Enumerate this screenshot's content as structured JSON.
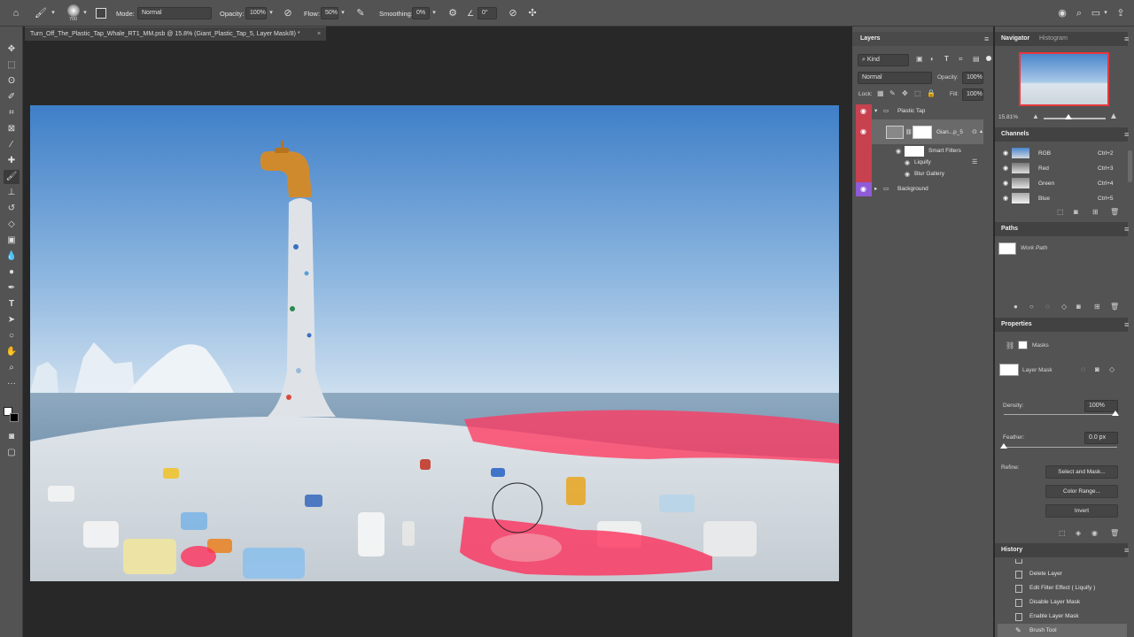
{
  "options_bar": {
    "brush_size": "700",
    "mode_label": "Mode:",
    "mode_value": "Normal",
    "opacity_label": "Opacity:",
    "opacity_value": "100%",
    "flow_label": "Flow:",
    "flow_value": "50%",
    "smoothing_label": "Smoothing:",
    "smoothing_value": "0%",
    "angle_value": "0°"
  },
  "document": {
    "tab_title": "Turn_Off_The_Plastic_Tap_Whale_RT1_MM.psb @ 15.8% (Giant_Plastic_Tap_5, Layer Mask/8) *"
  },
  "layers_panel": {
    "tab": "Layers",
    "filter_kind": "Kind",
    "blend_mode": "Normal",
    "opacity_label": "Opacity:",
    "opacity_value": "100%",
    "lock_label": "Lock:",
    "fill_label": "Fill:",
    "fill_value": "100%",
    "layers": [
      {
        "name": "Plastic Tap"
      },
      {
        "name": "Gian...p_5"
      },
      {
        "name": "Smart Filters"
      },
      {
        "name": "Liquify"
      },
      {
        "name": "Blur Gallery"
      },
      {
        "name": "Background"
      }
    ]
  },
  "navigator_panel": {
    "tab_navigator": "Navigator",
    "tab_histogram": "Histogram",
    "zoom": "15.81%"
  },
  "channels_panel": {
    "tab": "Channels",
    "channels": [
      {
        "name": "RGB",
        "shortcut": "Ctrl+2"
      },
      {
        "name": "Red",
        "shortcut": "Ctrl+3"
      },
      {
        "name": "Green",
        "shortcut": "Ctrl+4"
      },
      {
        "name": "Blue",
        "shortcut": "Ctrl+5"
      }
    ]
  },
  "paths_panel": {
    "tab": "Paths",
    "path_name": "Work Path"
  },
  "properties_panel": {
    "tab": "Properties",
    "section": "Masks",
    "mask_label": "Layer Mask",
    "density_label": "Density:",
    "density_value": "100%",
    "feather_label": "Feather:",
    "feather_value": "0.0 px",
    "refine_label": "Refine:",
    "select_and_mask": "Select and Mask...",
    "color_range": "Color Range...",
    "invert": "Invert"
  },
  "history_panel": {
    "tab": "History",
    "items": [
      "Delete Layer",
      "Edit Filter Effect ( Liquify )",
      "Disable Layer Mask",
      "Enable Layer Mask",
      "Brush Tool"
    ]
  },
  "colors": {
    "panel_bg": "#535353",
    "mask_overlay": "#ff2d5a",
    "layer_strip_red": "#c8414f",
    "layer_strip_purple": "#8f5bd6",
    "nav_view_box": "#e5383b"
  }
}
